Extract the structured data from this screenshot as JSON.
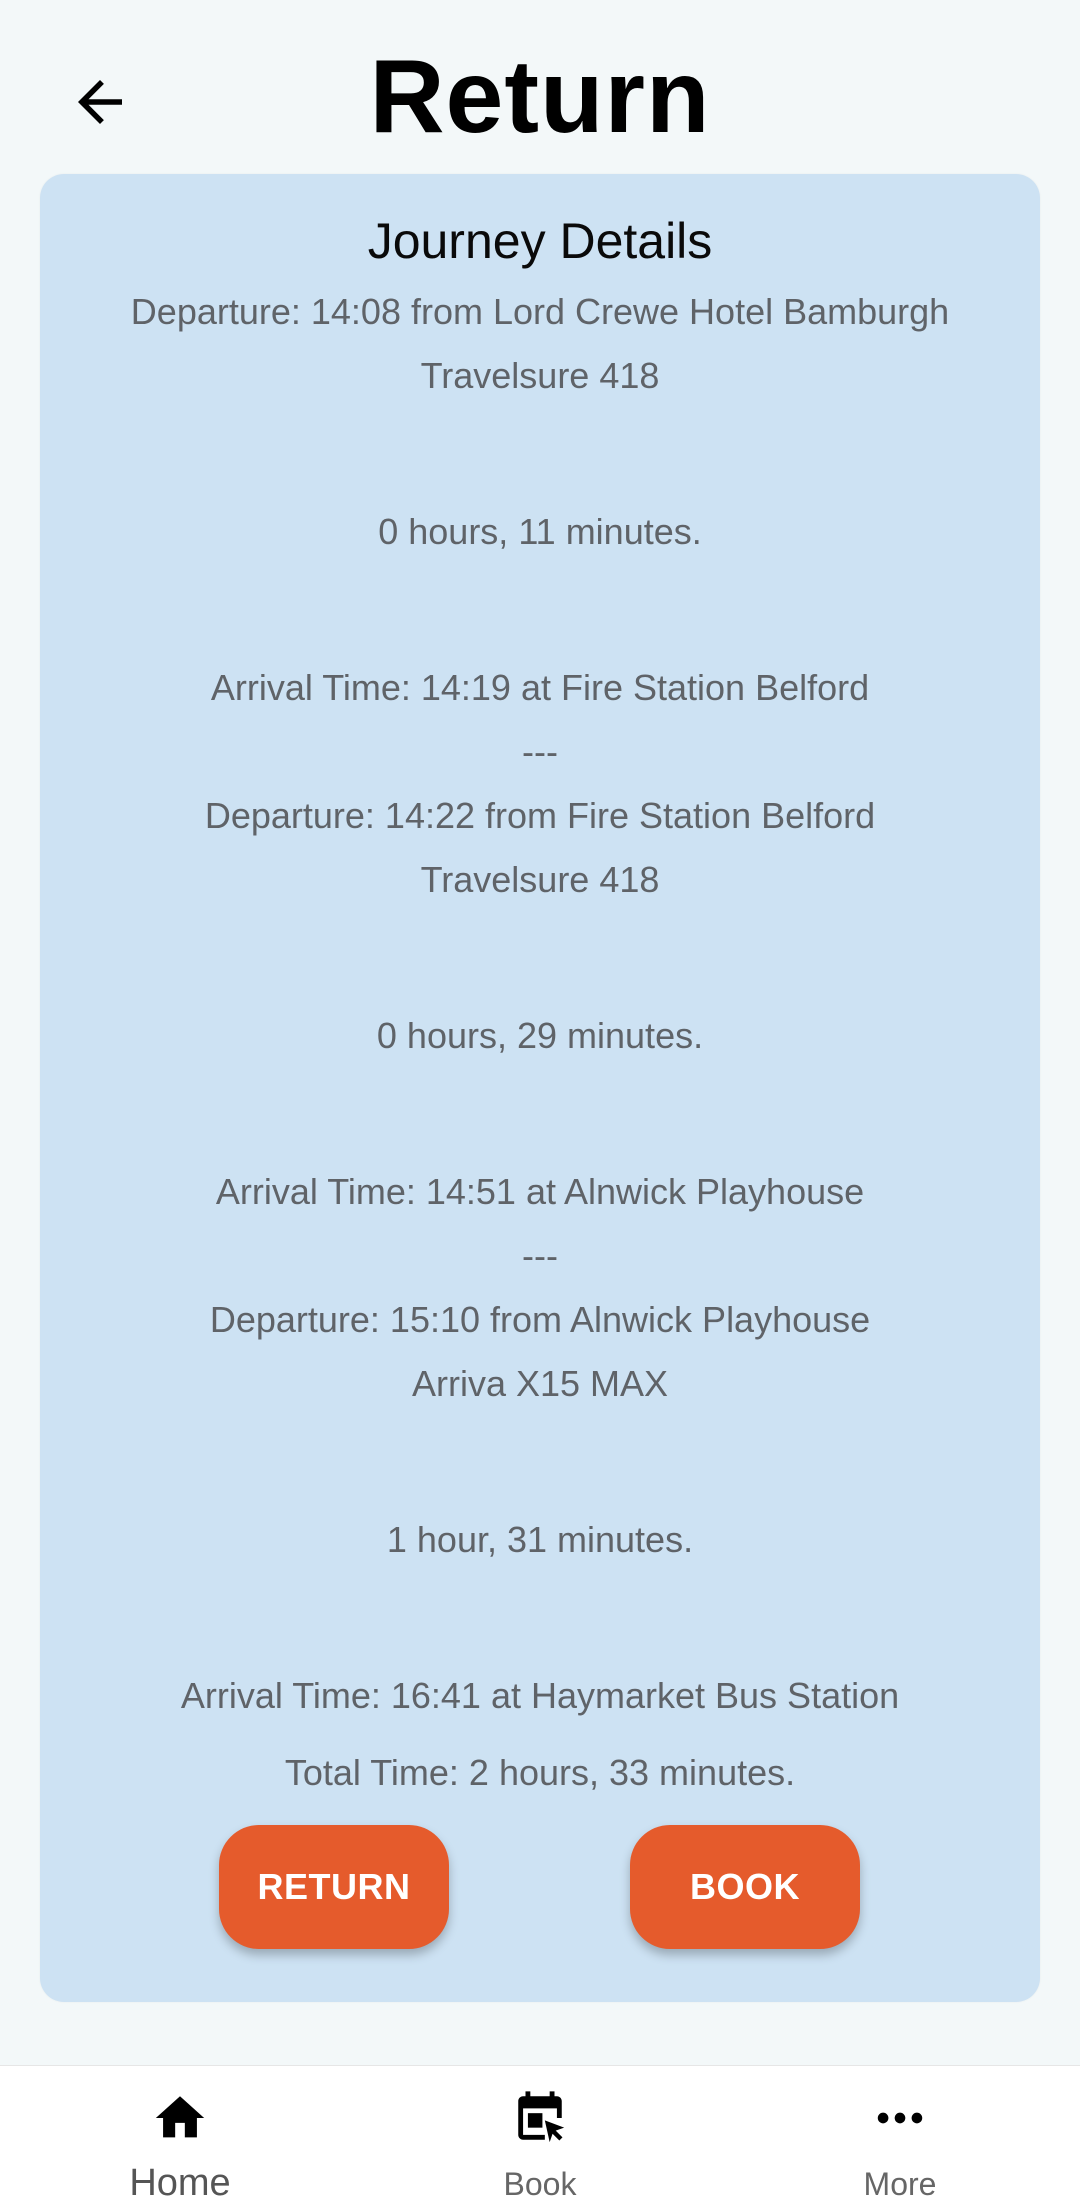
{
  "header": {
    "title": "Return",
    "back_icon": "arrow-back-icon"
  },
  "card": {
    "title": "Journey Details",
    "lines": [
      "Departure: 14:08 from Lord Crewe Hotel Bamburgh",
      "Travelsure 418",
      "0 hours, 11 minutes.",
      "Arrival Time: 14:19 at Fire Station Belford",
      "---",
      "Departure: 14:22 from Fire Station Belford",
      "Travelsure 418",
      "0 hours, 29 minutes.",
      "Arrival Time: 14:51 at Alnwick Playhouse",
      "---",
      "Departure: 15:10 from Alnwick Playhouse",
      "Arriva X15 MAX",
      "1 hour, 31 minutes.",
      "Arrival Time: 16:41 at Haymarket Bus Station",
      "Total Time: 2 hours, 33 minutes."
    ],
    "return_label": "RETURN",
    "book_label": "BOOK"
  },
  "nav": {
    "items": [
      {
        "label": "Home",
        "icon": "home-icon"
      },
      {
        "label": "Book",
        "icon": "calendar-book-icon"
      },
      {
        "label": "More",
        "icon": "more-horizontal-icon"
      }
    ]
  },
  "colors": {
    "accent": "#e55b2c",
    "card_bg": "#cde2f3",
    "page_bg": "#f3f8f9"
  }
}
